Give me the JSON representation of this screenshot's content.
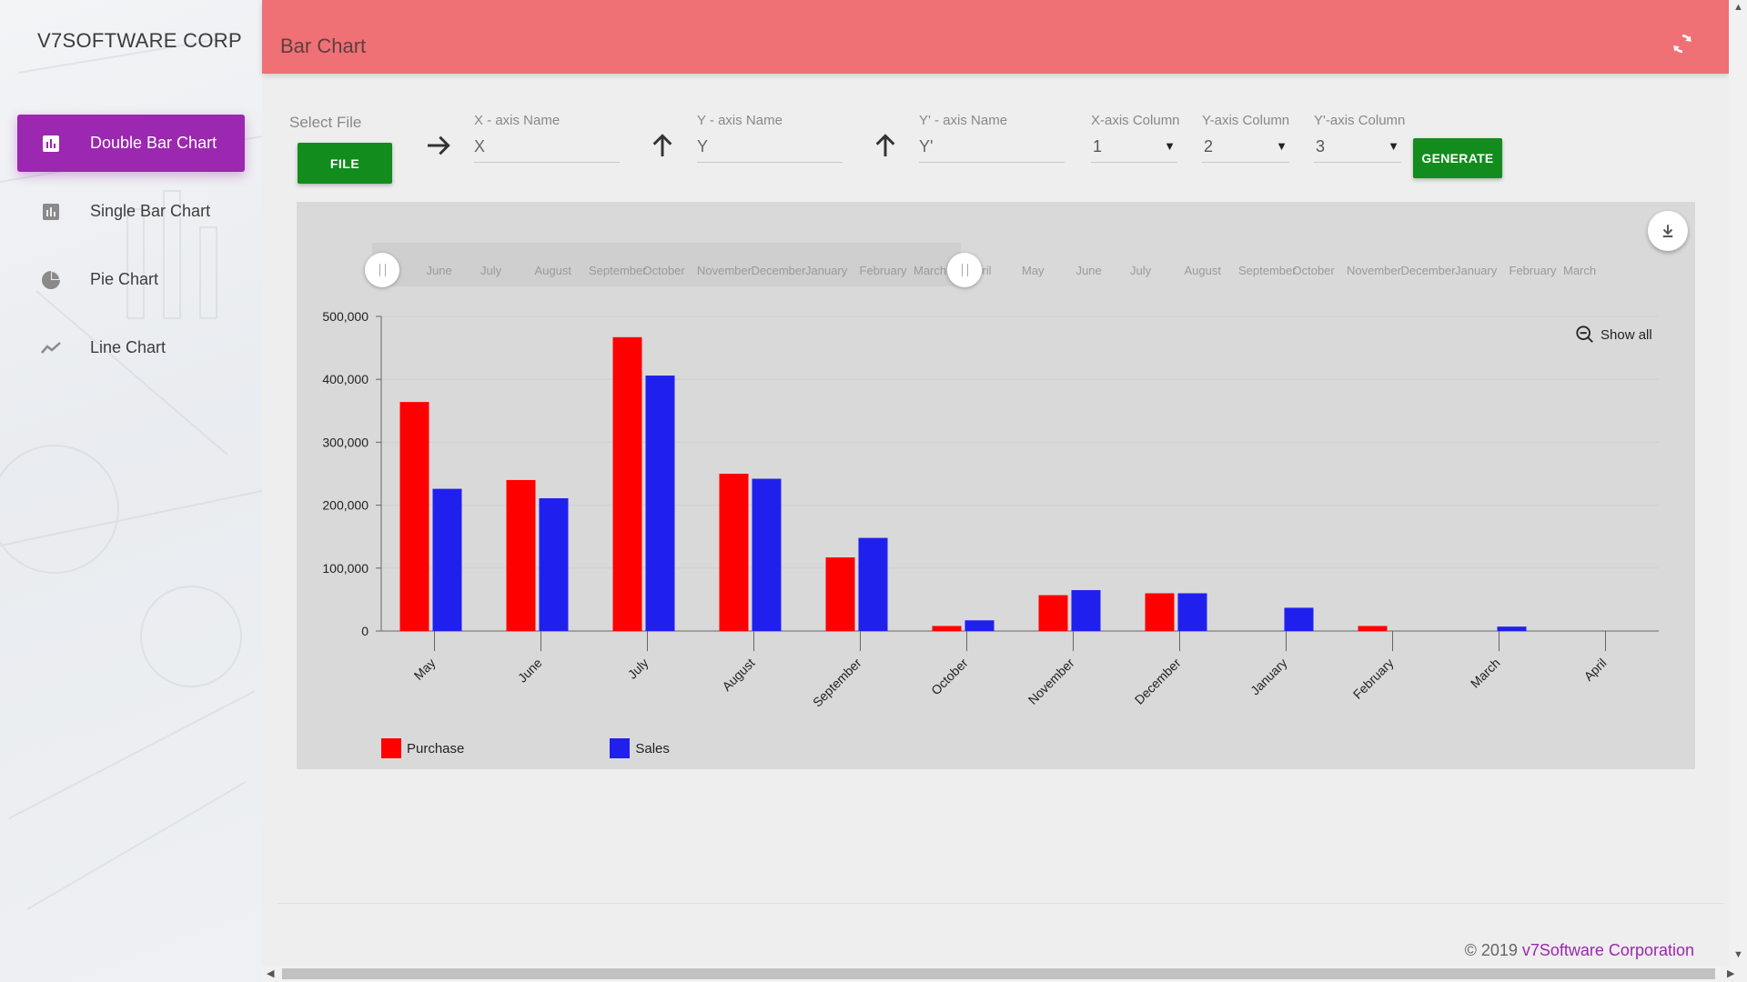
{
  "brand": "V7SOFTWARE CORP",
  "nav": [
    {
      "label": "Double Bar Chart",
      "icon": "bar-chart-icon",
      "active": true
    },
    {
      "label": "Single Bar Chart",
      "icon": "bar-chart-icon",
      "active": false
    },
    {
      "label": "Pie Chart",
      "icon": "pie-chart-icon",
      "active": false
    },
    {
      "label": "Line Chart",
      "icon": "line-chart-icon",
      "active": false
    }
  ],
  "header": {
    "title": "Bar Chart"
  },
  "form": {
    "select_file_label": "Select File",
    "file_button": "FILE",
    "x_axis_name_label": "X - axis Name",
    "x_axis_name_value": "X",
    "y_axis_name_label": "Y - axis Name",
    "y_axis_name_value": "Y",
    "y2_axis_name_label": "Y' - axis Name",
    "y2_axis_name_value": "Y'",
    "x_col_label": "X-axis Column",
    "x_col_value": "1",
    "y_col_label": "Y-axis Column",
    "y_col_value": "2",
    "y2_col_label": "Y'-axis Column",
    "y2_col_value": "3",
    "generate_button": "GENERATE"
  },
  "chart_controls": {
    "show_all": "Show all",
    "strip_labels": [
      "May",
      "June",
      "July",
      "August",
      "September",
      "October",
      "November",
      "December",
      "January",
      "February",
      "March",
      "April",
      "May",
      "June",
      "July",
      "August",
      "September",
      "October",
      "November",
      "December",
      "January",
      "February",
      "March"
    ]
  },
  "chart_data": {
    "type": "bar",
    "categories": [
      "May",
      "June",
      "July",
      "August",
      "September",
      "October",
      "November",
      "December",
      "January",
      "February",
      "March",
      "April"
    ],
    "series": [
      {
        "name": "Purchase",
        "color": "#ff0000",
        "values": [
          364000,
          240000,
          467000,
          250000,
          117000,
          8000,
          57000,
          60000,
          0,
          8000,
          0,
          0
        ]
      },
      {
        "name": "Sales",
        "color": "#2020ee",
        "values": [
          226000,
          211000,
          406000,
          242000,
          148000,
          17000,
          65000,
          60000,
          37000,
          0,
          7000,
          0
        ]
      }
    ],
    "ylim": [
      0,
      500000
    ],
    "yticks": [
      "0",
      "100,000",
      "200,000",
      "300,000",
      "400,000",
      "500,000"
    ],
    "grid": true,
    "legend": "bottom-left"
  },
  "footer": {
    "copyright": "© 2019 ",
    "company": "v7Software Corporation"
  }
}
